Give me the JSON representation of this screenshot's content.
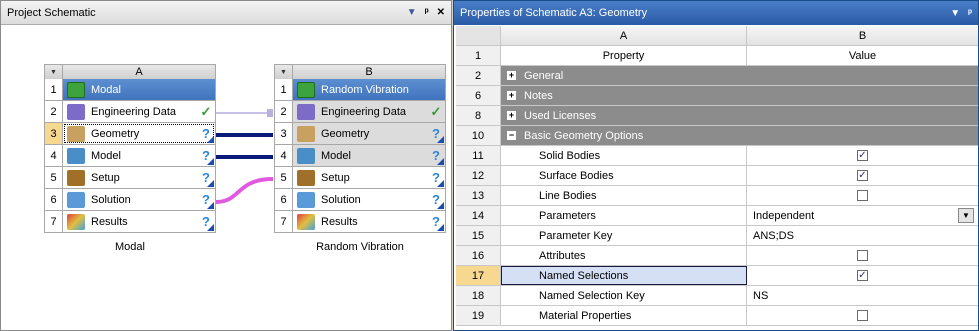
{
  "left_panel": {
    "title": "Project Schematic",
    "controls": {
      "menu": "▼",
      "pin": "ᵖ",
      "close": "✕"
    }
  },
  "right_panel": {
    "title": "Properties of Schematic A3: Geometry",
    "controls": {
      "menu": "▼",
      "pin": "ᵖ"
    }
  },
  "systemA": {
    "col": "A",
    "label": "Modal",
    "rows": [
      {
        "num": "1",
        "label": "Modal",
        "icon": "modal-icon",
        "status": ""
      },
      {
        "num": "2",
        "label": "Engineering Data",
        "icon": "engineering-data-icon",
        "status": "✓"
      },
      {
        "num": "3",
        "label": "Geometry",
        "icon": "geometry-icon",
        "status": "?"
      },
      {
        "num": "4",
        "label": "Model",
        "icon": "model-icon",
        "status": "?"
      },
      {
        "num": "5",
        "label": "Setup",
        "icon": "setup-icon",
        "status": "?"
      },
      {
        "num": "6",
        "label": "Solution",
        "icon": "solution-icon",
        "status": "?"
      },
      {
        "num": "7",
        "label": "Results",
        "icon": "results-icon",
        "status": "?"
      }
    ]
  },
  "systemB": {
    "col": "B",
    "label": "Random Vibration",
    "rows": [
      {
        "num": "1",
        "label": "Random Vibration",
        "icon": "random-vibration-icon",
        "status": ""
      },
      {
        "num": "2",
        "label": "Engineering Data",
        "icon": "engineering-data-icon",
        "status": "✓"
      },
      {
        "num": "3",
        "label": "Geometry",
        "icon": "geometry-icon",
        "status": "?"
      },
      {
        "num": "4",
        "label": "Model",
        "icon": "model-icon",
        "status": "?"
      },
      {
        "num": "5",
        "label": "Setup",
        "icon": "setup-icon",
        "status": "?"
      },
      {
        "num": "6",
        "label": "Solution",
        "icon": "solution-icon",
        "status": "?"
      },
      {
        "num": "7",
        "label": "Results",
        "icon": "results-icon",
        "status": "?"
      }
    ]
  },
  "props": {
    "colA": "A",
    "colB": "B",
    "header": {
      "num": "1",
      "property": "Property",
      "value": "Value"
    },
    "rows": [
      {
        "num": "2",
        "type": "group",
        "property": "General",
        "expander": "+"
      },
      {
        "num": "6",
        "type": "group",
        "property": "Notes",
        "expander": "+"
      },
      {
        "num": "8",
        "type": "group",
        "property": "Used Licenses",
        "expander": "+"
      },
      {
        "num": "10",
        "type": "group",
        "property": "Basic Geometry Options",
        "expander": "−"
      },
      {
        "num": "11",
        "type": "check",
        "property": "Solid Bodies",
        "checked": true
      },
      {
        "num": "12",
        "type": "check",
        "property": "Surface Bodies",
        "checked": true
      },
      {
        "num": "13",
        "type": "check",
        "property": "Line Bodies",
        "checked": false
      },
      {
        "num": "14",
        "type": "dropdown",
        "property": "Parameters",
        "value": "Independent"
      },
      {
        "num": "15",
        "type": "text",
        "property": "Parameter Key",
        "value": "ANS;DS"
      },
      {
        "num": "16",
        "type": "check",
        "property": "Attributes",
        "checked": false
      },
      {
        "num": "17",
        "type": "check",
        "property": "Named Selections",
        "checked": true,
        "selected": true
      },
      {
        "num": "18",
        "type": "text",
        "property": "Named Selection Key",
        "value": "NS"
      },
      {
        "num": "19",
        "type": "check",
        "property": "Material Properties",
        "checked": false
      }
    ]
  },
  "colors": {
    "title_blue": "#3f73bd",
    "group_gray": "#8c8c8c",
    "link_dark": "#0a1a7a",
    "link_magenta": "#e05ae0",
    "selected_row": "#f6d890"
  }
}
